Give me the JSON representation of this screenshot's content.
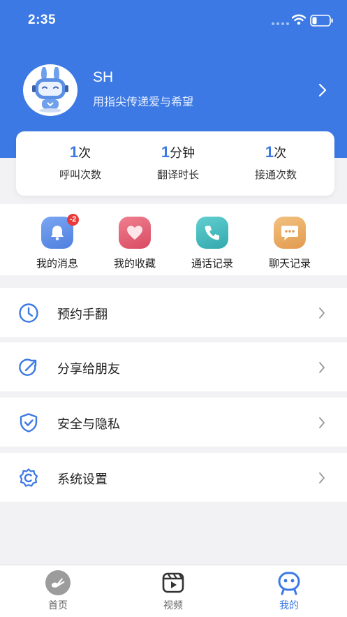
{
  "status_bar": {
    "time": "2:35"
  },
  "profile": {
    "name": "SH",
    "motto": "用指尖传递爱与希望"
  },
  "stats": [
    {
      "value": "1",
      "unit": "次",
      "label": "呼叫次数"
    },
    {
      "value": "1",
      "unit": "分钟",
      "label": "翻译时长"
    },
    {
      "value": "1",
      "unit": "次",
      "label": "接通次数"
    }
  ],
  "quick_actions": [
    {
      "label": "我的消息",
      "icon": "bell-icon",
      "badge": "-2",
      "color": "#4f86e8"
    },
    {
      "label": "我的收藏",
      "icon": "heart-icon",
      "color": "#e0576b"
    },
    {
      "label": "通话记录",
      "icon": "phone-icon",
      "color": "#3bb6b9"
    },
    {
      "label": "聊天记录",
      "icon": "chat-icon",
      "color": "#e8a35a"
    }
  ],
  "menu": [
    {
      "label": "预约手翻",
      "icon": "clock-icon"
    },
    {
      "label": "分享给朋友",
      "icon": "share-icon"
    },
    {
      "label": "安全与隐私",
      "icon": "shield-icon"
    },
    {
      "label": "系统设置",
      "icon": "settings-icon"
    }
  ],
  "tabs": [
    {
      "label": "首页",
      "icon": "home-hand-icon",
      "active": false
    },
    {
      "label": "视频",
      "icon": "video-icon",
      "active": false
    },
    {
      "label": "我的",
      "icon": "profile-robot-icon",
      "active": true
    }
  ],
  "colors": {
    "accent": "#3c79e4",
    "badge": "#e83a3a",
    "background": "#f2f2f4"
  }
}
